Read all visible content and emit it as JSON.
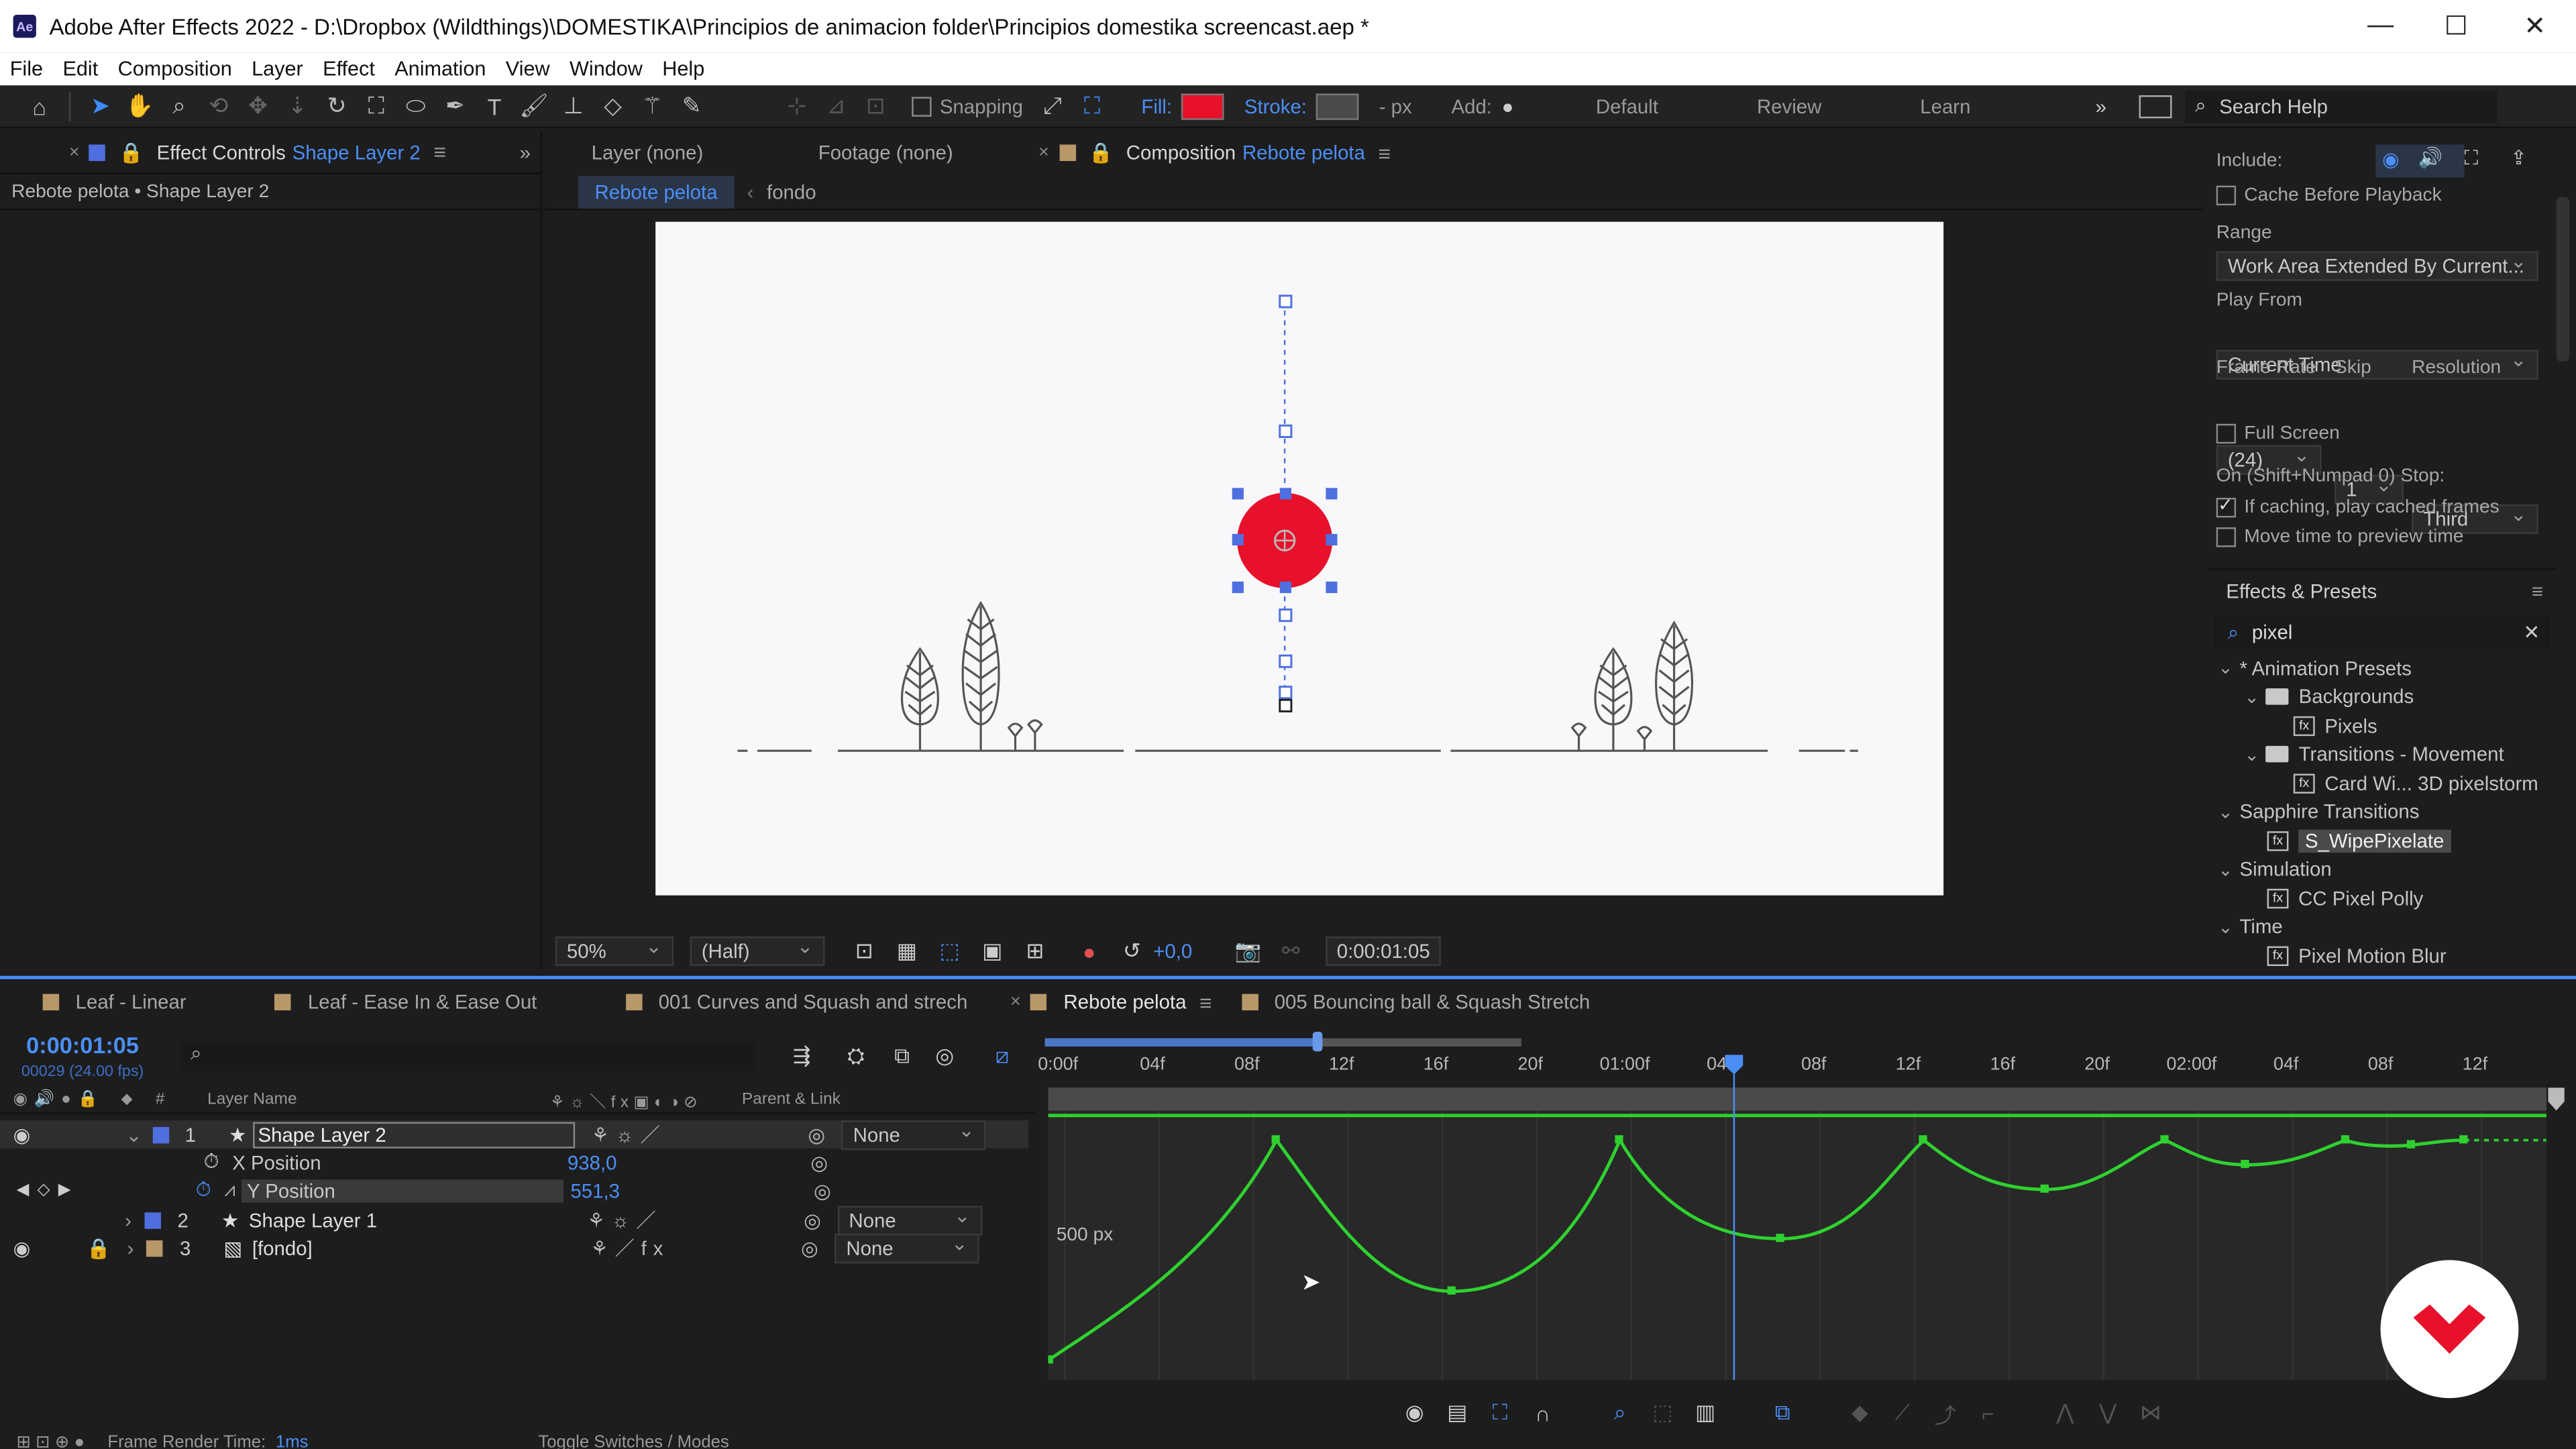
{
  "window": {
    "title": "Adobe After Effects 2022 - D:\\Dropbox (Wildthings)\\DOMESTIKA\\Principios de animacion folder\\Principios domestika screencast.aep *",
    "app_icon": "Ae",
    "controls": {
      "minimize": "—",
      "maximize": "☐",
      "close": "✕"
    }
  },
  "menu": [
    "File",
    "Edit",
    "Composition",
    "Layer",
    "Effect",
    "Animation",
    "View",
    "Window",
    "Help"
  ],
  "toolbar": {
    "snapping_label": "Snapping",
    "fill_label": "Fill:",
    "fill_color": "#e8102a",
    "stroke_label": "Stroke:",
    "stroke_unit": "- px",
    "add_label": "Add:",
    "workspaces": [
      "Default",
      "Review",
      "Learn"
    ],
    "search_placeholder": "Search Help"
  },
  "effect_controls": {
    "tab_label": "Effect Controls",
    "tab_target": "Shape Layer 2",
    "breadcrumb": "Rebote pelota • Shape Layer 2"
  },
  "viewer": {
    "layer_tab": "Layer  (none)",
    "footage_tab": "Footage  (none)",
    "comp_tab_label": "Composition",
    "comp_tab_name": "Rebote pelota",
    "nav_active": "Rebote pelota",
    "nav_other": "fondo",
    "zoom": "50%",
    "resolution": "(Half)",
    "exposure": "+0,0",
    "timecode": "0:00:01:05",
    "ball_color": "#e8102a"
  },
  "preview": {
    "include_label": "Include:",
    "cache_label": "Cache Before Playback",
    "range_label": "Range",
    "range_value": "Work Area Extended By Current...",
    "play_from_label": "Play From",
    "play_from_value": "Current Time",
    "frame_rate_label": "Frame Rate",
    "skip_label": "Skip",
    "resolution_label": "Resolution",
    "frame_rate_value": "(24)",
    "skip_value": "1",
    "resolution_value": "Third",
    "full_screen_label": "Full Screen",
    "stop_label": "On (Shift+Numpad 0) Stop:",
    "if_caching_label": "If caching, play cached frames",
    "move_time_label": "Move time to preview time"
  },
  "effects_presets": {
    "title": "Effects & Presets",
    "search_value": "pixel",
    "tree": [
      {
        "label": "* Animation Presets",
        "level": 0,
        "kind": "group"
      },
      {
        "label": "Backgrounds",
        "level": 1,
        "kind": "folder"
      },
      {
        "label": "Pixels",
        "level": 2,
        "kind": "preset"
      },
      {
        "label": "Transitions - Movement",
        "level": 1,
        "kind": "folder"
      },
      {
        "label": "Card Wi... 3D pixelstorm",
        "level": 2,
        "kind": "preset"
      },
      {
        "label": "Sapphire Transitions",
        "level": 0,
        "kind": "group"
      },
      {
        "label": "S_WipePixelate",
        "level": 1,
        "kind": "effect",
        "selected": true
      },
      {
        "label": "Simulation",
        "level": 0,
        "kind": "group"
      },
      {
        "label": "CC Pixel Polly",
        "level": 1,
        "kind": "effect"
      },
      {
        "label": "Time",
        "level": 0,
        "kind": "group"
      },
      {
        "label": "Pixel Motion Blur",
        "level": 1,
        "kind": "effect"
      }
    ]
  },
  "timeline": {
    "tabs": [
      {
        "label": "Leaf - Linear",
        "active": false
      },
      {
        "label": "Leaf - Ease In & Ease Out",
        "active": false
      },
      {
        "label": "001 Curves and Squash and strech",
        "active": false
      },
      {
        "label": "Rebote pelota",
        "active": true
      },
      {
        "label": "005 Bouncing ball & Squash Stretch",
        "active": false
      }
    ],
    "current_time": "0:00:01:05",
    "frame_info": "00029 (24.00 fps)",
    "search_placeholder": "",
    "col_layer_name": "Layer Name",
    "col_num": "#",
    "col_parent": "Parent & Link",
    "layers": [
      {
        "num": "1",
        "name": "Shape Layer 2",
        "parent": "None",
        "color": "#4e6fe0",
        "selected": true
      },
      {
        "prop": "X Position",
        "value": "938,0"
      },
      {
        "prop": "Y Position",
        "value": "551,3"
      },
      {
        "num": "2",
        "name": "Shape Layer 1",
        "parent": "None",
        "color": "#4e6fe0"
      },
      {
        "num": "3",
        "name": "[fondo]",
        "parent": "None",
        "color": "#b89769"
      }
    ],
    "ruler_labels": [
      "0:00f",
      "04f",
      "08f",
      "12f",
      "16f",
      "20f",
      "01:00f",
      "04f",
      "08f",
      "12f",
      "16f",
      "20f",
      "02:00f",
      "04f",
      "08f",
      "12f"
    ],
    "graph_unit_label": "500 px",
    "curve_color": "#2fd12f",
    "footer_render_label": "Frame Render Time:",
    "footer_render_value": "1ms",
    "footer_toggle": "Toggle Switches / Modes"
  },
  "watermark": {
    "brand_color": "#e8102a"
  }
}
